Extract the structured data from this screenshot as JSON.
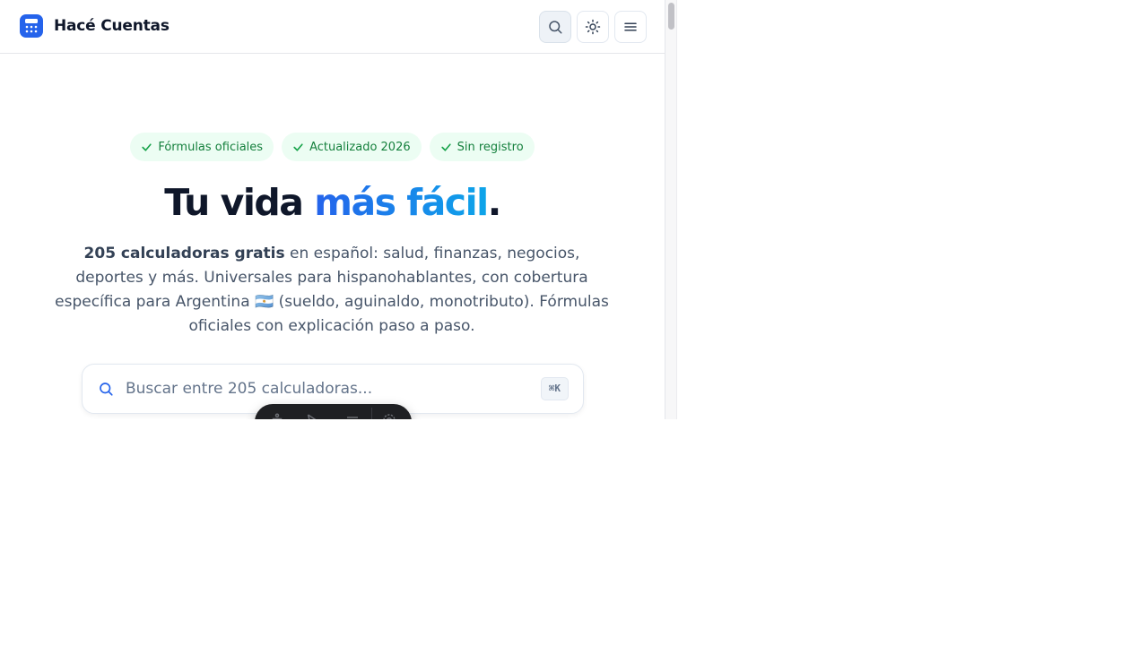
{
  "header": {
    "brand": "Hacé Cuentas",
    "logo_icon": "calculator-icon",
    "brand_color": "#2563eb",
    "buttons": [
      {
        "name": "search-button",
        "icon": "search-icon"
      },
      {
        "name": "theme-toggle-button",
        "icon": "sun-icon"
      },
      {
        "name": "menu-button",
        "icon": "hamburger-menu-icon"
      }
    ]
  },
  "badges": [
    {
      "label": "Fórmulas oficiales",
      "icon": "check-icon"
    },
    {
      "label": "Actualizado 2026",
      "icon": "check-icon"
    },
    {
      "label": "Sin registro",
      "icon": "check-icon"
    }
  ],
  "hero": {
    "title_part1": "Tu vida ",
    "title_accent": "más fácil",
    "title_end": ".",
    "accent_colors": [
      "#2563eb",
      "#0ea5e9"
    ]
  },
  "description": {
    "bold": "205 calculadoras gratis",
    "text_a": " en español: salud, finanzas, negocios, deportes y más. Universales para hispanohablantes, con cobertura específica para Argentina ",
    "flag": "🇦🇷",
    "text_b": " (sueldo, aguinaldo, monotributo). Fórmulas oficiales con explicación paso a paso."
  },
  "search": {
    "placeholder": "Buscar entre 205 calculadoras...",
    "value": "",
    "shortcut": "⌘K",
    "icon": "search-icon"
  },
  "colors": {
    "badge_bg": "#ecfdf3",
    "badge_text": "#15803d",
    "title": "#0f172a",
    "body_text": "#475569"
  }
}
